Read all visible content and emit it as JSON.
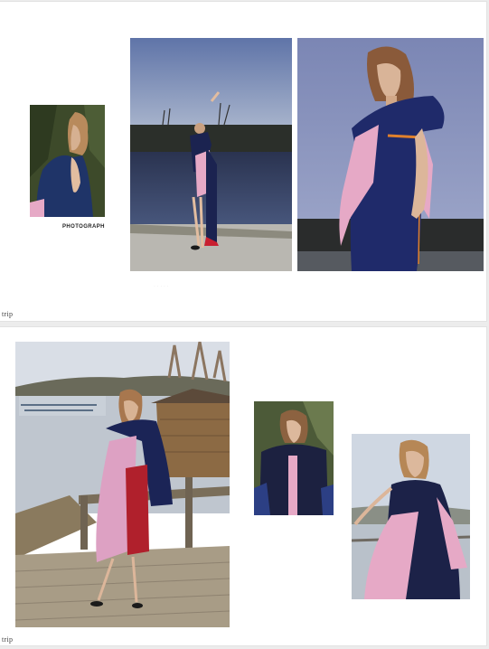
{
  "spreads": [
    {
      "caption": "PHOTOGRAPH",
      "footer": "trip",
      "ghost_text": "·  ·  ·  ·  ·"
    },
    {
      "footer": "trip"
    }
  ],
  "photos": [
    {
      "id": "back-portrait",
      "desc_icon": "photo-icon"
    },
    {
      "id": "lake-pose",
      "desc_icon": "photo-icon"
    },
    {
      "id": "dusk-portrait",
      "desc_icon": "photo-icon"
    },
    {
      "id": "dock-full-length",
      "desc_icon": "photo-icon"
    },
    {
      "id": "vest-closeup",
      "desc_icon": "photo-icon"
    },
    {
      "id": "railing-portrait",
      "desc_icon": "photo-icon"
    }
  ],
  "colors": {
    "navy": "#1f2a5c",
    "pink": "#e6a9c6",
    "page": "#ffffff",
    "background": "#ececec"
  }
}
